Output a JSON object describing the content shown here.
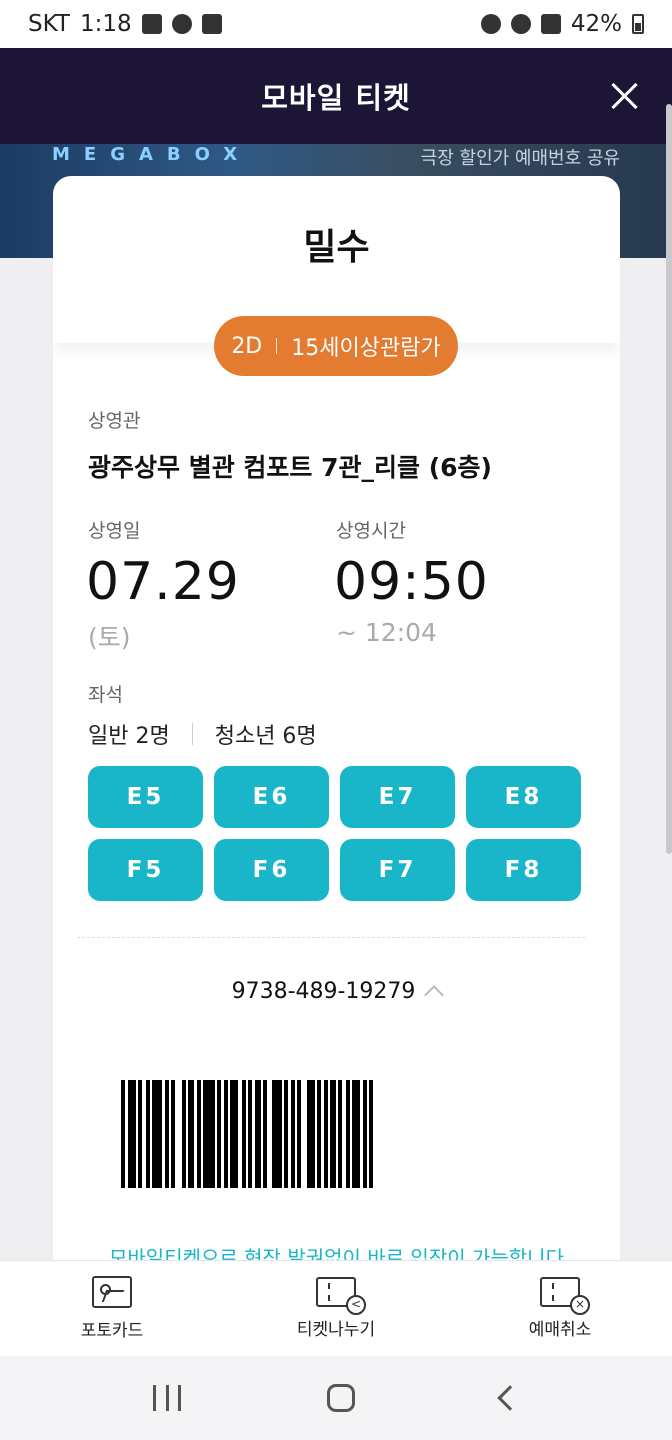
{
  "status_bar": {
    "carrier": "SKT",
    "time": "1:18",
    "battery": "42%"
  },
  "header": {
    "title": "모바일 티켓"
  },
  "banner": {
    "logo": "MEGABOX",
    "faded_text": "극장 할인가   예매번호 공유"
  },
  "ticket": {
    "movie_title": "밀수",
    "format": "2D",
    "rating": "15세이상관람가",
    "theater_label": "상영관",
    "theater_name": "광주상무 별관 컴포트 7관_리클 (6층)",
    "date_label": "상영일",
    "date": "07.29",
    "weekday": "(토)",
    "time_label": "상영시간",
    "start_time": "09:50",
    "end_time": "~  12:04",
    "seat_label": "좌석",
    "adult_count": "일반 2명",
    "youth_count": "청소년 6명",
    "seats": [
      "E5",
      "E6",
      "E7",
      "E8",
      "F5",
      "F6",
      "F7",
      "F8"
    ],
    "ticket_number": "9738-489-19279",
    "notice": "모바일티켓으로 현장 발권없이 바로 입장이 가능합니다"
  },
  "actions": {
    "photo_card": "포토카드",
    "share_ticket": "티켓나누기",
    "cancel_booking": "예매취소"
  },
  "colors": {
    "header_bg": "#1c1535",
    "rating_pill": "#e37b31",
    "seat_chip": "#19b6c9"
  }
}
